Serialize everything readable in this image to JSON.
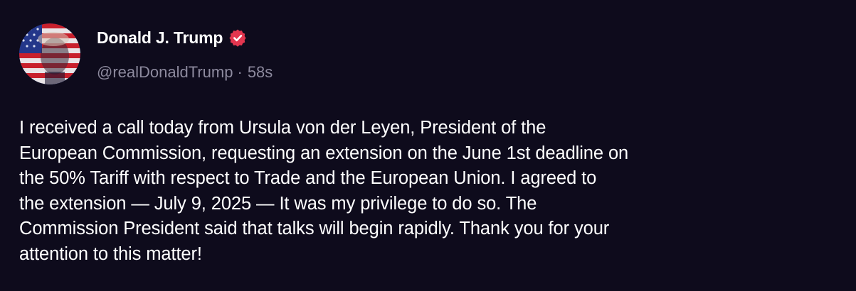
{
  "author": {
    "display_name": "Donald J. Trump",
    "handle": "@realDonaldTrump",
    "separator": "·",
    "timestamp": "58s",
    "verified": true,
    "avatar_icon": "profile-photo-flag-overlay"
  },
  "post": {
    "text": "I received a call today from Ursula von der Leyen, President of the\nEuropean Commission, requesting an extension on the June 1st deadline on\nthe 50% Tariff with respect to Trade and the European Union. I agreed to\nthe extension — July 9, 2025 — It was my privilege to do so. The\nCommission President said that talks will begin rapidly. Thank you for your\nattention to this matter!"
  },
  "colors": {
    "background": "#0e0b1c",
    "text": "#ffffff",
    "muted": "#8d8a9e",
    "verified_badge": "#e3364f"
  }
}
